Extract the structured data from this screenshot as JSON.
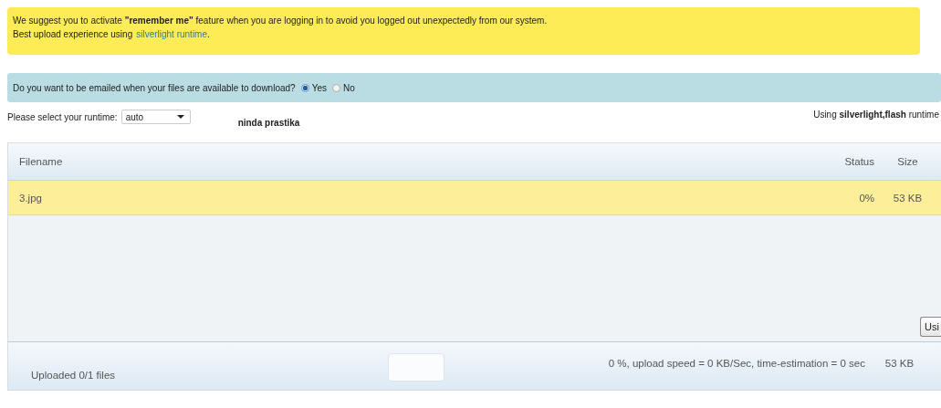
{
  "notice": {
    "lines": [
      "We suggest you to activate **\"remember me\"** feature when you are logging in to avoid you logged out unexpectedly from our system.",
      "Best upload experience using"
    ],
    "link": "silverlight runtime",
    "link_suffix": "."
  },
  "email_prompt": {
    "question": "Do you want to be emailed when your files are available to download?",
    "options": [
      {
        "label": "Yes",
        "selected": true
      },
      {
        "label": "No",
        "selected": false
      }
    ]
  },
  "runtime": {
    "label": "Please select your runtime:",
    "value": "auto",
    "user": "ninda prastika",
    "status": "Using **silverlight,flash** runtime"
  },
  "table": {
    "columns": [
      "Filename",
      "Status",
      "Size"
    ],
    "rows": [
      {
        "cells": [
          "3.jpg",
          "0%",
          "53 KB"
        ],
        "selected": true
      }
    ],
    "side_button": "Usi",
    "footer": {
      "uploaded": "Uploaded 0/1 files",
      "progress": "0 %, upload speed = 0 KB/Sec, time-estimation = 0 sec",
      "size": "53 KB",
      "level": 0
    }
  }
}
